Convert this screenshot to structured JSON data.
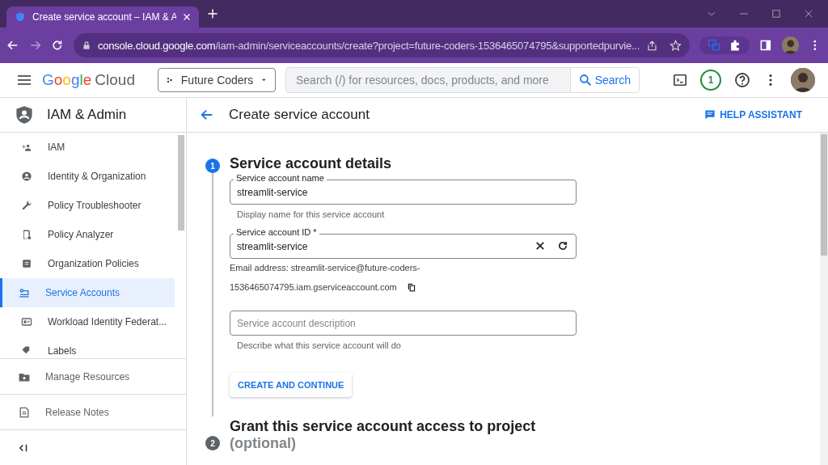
{
  "browser": {
    "tab": {
      "title": "Create service account – IAM & A",
      "selected": true
    },
    "url": {
      "host": "console.cloud.google.com",
      "path": "/iam-admin/serviceaccounts/create?project=future-coders-1536465074795&supportedpurvie..."
    }
  },
  "header": {
    "logo": {
      "brand": "Google",
      "product": "Cloud"
    },
    "project": "Future Coders",
    "search": {
      "placeholder": "Search (/) for resources, docs, products, and more",
      "button": "Search"
    },
    "notifications": "1"
  },
  "sidebar": {
    "title": "IAM & Admin",
    "items": [
      {
        "label": "IAM",
        "selected": false
      },
      {
        "label": "Identity & Organization",
        "selected": false
      },
      {
        "label": "Policy Troubleshooter",
        "selected": false
      },
      {
        "label": "Policy Analyzer",
        "selected": false
      },
      {
        "label": "Organization Policies",
        "selected": false
      },
      {
        "label": "Service Accounts",
        "selected": true
      },
      {
        "label": "Workload Identity Federat...",
        "selected": false
      },
      {
        "label": "Labels",
        "selected": false
      }
    ],
    "footer": [
      {
        "label": "Manage Resources"
      },
      {
        "label": "Release Notes"
      }
    ]
  },
  "page": {
    "title": "Create service account",
    "help": "HELP ASSISTANT",
    "step1": {
      "number": "1",
      "title": "Service account details",
      "active": true,
      "name_field": {
        "label": "Service account name",
        "value": "streamlit-service",
        "hint": "Display name for this service account"
      },
      "id_field": {
        "label": "Service account ID *",
        "value": "streamlit-service"
      },
      "email": [
        "Email address: streamlit-service@future-coders-",
        "1536465074795.iam.gserviceaccount.com"
      ],
      "description_field": {
        "placeholder": "Service account description",
        "hint": "Describe what this service account will do"
      },
      "button": "CREATE AND CONTINUE"
    },
    "step2": {
      "number": "2",
      "title": "Grant this service account access to project",
      "note": "(optional)",
      "active": false
    }
  }
}
